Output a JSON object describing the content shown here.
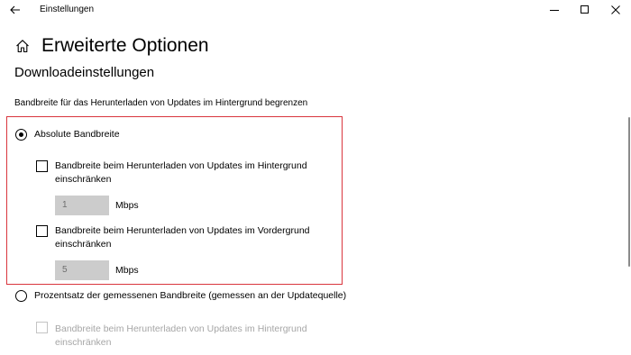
{
  "window": {
    "title": "Einstellungen",
    "controls": {
      "back_icon": "back-arrow-icon",
      "minimize_icon": "minimize-icon",
      "maximize_icon": "maximize-icon",
      "close_icon": "close-icon"
    }
  },
  "header": {
    "home_icon": "home-icon",
    "title": "Erweiterte Optionen"
  },
  "section": {
    "title": "Downloadeinstellungen",
    "description": "Bandbreite für das Herunterladen von Updates im Hintergrund begrenzen"
  },
  "options": {
    "absolute": {
      "label": "Absolute Bandbreite",
      "selected": true,
      "background": {
        "label_line1": "Bandbreite beim Herunterladen von Updates im Hintergrund",
        "label_line2": "einschränken",
        "checked": false,
        "value": "1",
        "unit": "Mbps"
      },
      "foreground": {
        "label_line1": "Bandbreite beim Herunterladen von Updates im Vordergrund",
        "label_line2": "einschränken",
        "checked": false,
        "value": "5",
        "unit": "Mbps"
      }
    },
    "percentage": {
      "label": "Prozentsatz der gemessenen Bandbreite (gemessen an der Updatequelle)",
      "selected": false,
      "background": {
        "label_line1": "Bandbreite beim Herunterladen von Updates im Hintergrund",
        "label_line2": "einschränken",
        "checked": false,
        "disabled": true
      }
    }
  },
  "colors": {
    "highlight_border": "#d9363e",
    "disabled_text": "#a6a6a6",
    "input_background": "#cccccc"
  }
}
